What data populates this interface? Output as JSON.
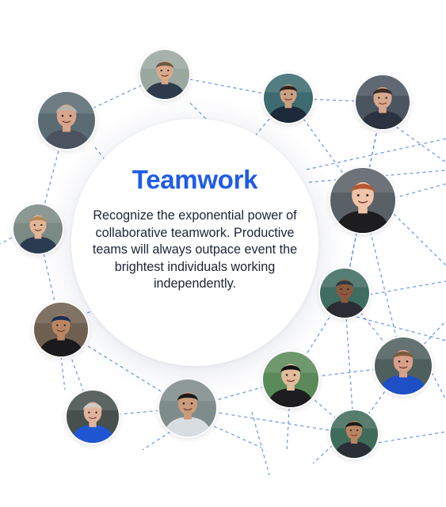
{
  "hero": {
    "title": "Teamwork",
    "body": "Recognize the exponential power of collaborative teamwork. Productive teams will always outpace event the brightest individuals working independently."
  },
  "colors": {
    "accent": "#1f5ce6",
    "connector": "#4a7ff0",
    "text": "#1c2333"
  },
  "team_photos": [
    {
      "icon": "person-photo",
      "shirt": "#2f3b4a",
      "bg": "#9aa8a0",
      "skin": "#d9a98a",
      "hair": "#6b5a44"
    },
    {
      "icon": "person-photo",
      "shirt": "#4b5360",
      "bg": "#5b6b73",
      "skin": "#d7a48c",
      "hair": "#b9b4ab"
    },
    {
      "icon": "person-photo",
      "shirt": "#1c2a3a",
      "bg": "#3d6b70",
      "skin": "#caa080",
      "hair": "#2b211b"
    },
    {
      "icon": "person-photo",
      "shirt": "#2b3340",
      "bg": "#4a5560",
      "skin": "#d7a88e",
      "hair": "#3a2d23"
    },
    {
      "icon": "person-photo",
      "shirt": "#2a3b52",
      "bg": "#7c8a86",
      "skin": "#e2b596",
      "hair": "#b08a58"
    },
    {
      "icon": "person-photo",
      "shirt": "#1d1d1f",
      "bg": "#596066",
      "skin": "#f0c4aa",
      "hair": "#b4582f"
    },
    {
      "icon": "person-photo",
      "shirt": "#2a2d33",
      "bg": "#3f6d60",
      "skin": "#8a5a3e",
      "hair": "#2e3a46"
    },
    {
      "icon": "person-photo",
      "shirt": "#1a1a1c",
      "bg": "#6f5f50",
      "skin": "#b98662",
      "hair": "#1e2f52"
    },
    {
      "icon": "person-photo",
      "shirt": "#1f4fc4",
      "bg": "#4f5f5e",
      "skin": "#d8a08a",
      "hair": "#7a5b3e"
    },
    {
      "icon": "person-photo",
      "shirt": "#1d1d1f",
      "bg": "#5b8a5a",
      "skin": "#e2bc9a",
      "hair": "#121212"
    },
    {
      "icon": "person-photo",
      "shirt": "#d8dde2",
      "bg": "#7f8c8c",
      "skin": "#c99c7c",
      "hair": "#1b1b1b"
    },
    {
      "icon": "person-photo",
      "shirt": "#1f55d0",
      "bg": "#47504d",
      "skin": "#e0b39c",
      "hair": "#cfcac3"
    },
    {
      "icon": "person-photo",
      "shirt": "#2a2f36",
      "bg": "#3f6b5a",
      "skin": "#b98463",
      "hair": "#1b1b1b"
    }
  ]
}
